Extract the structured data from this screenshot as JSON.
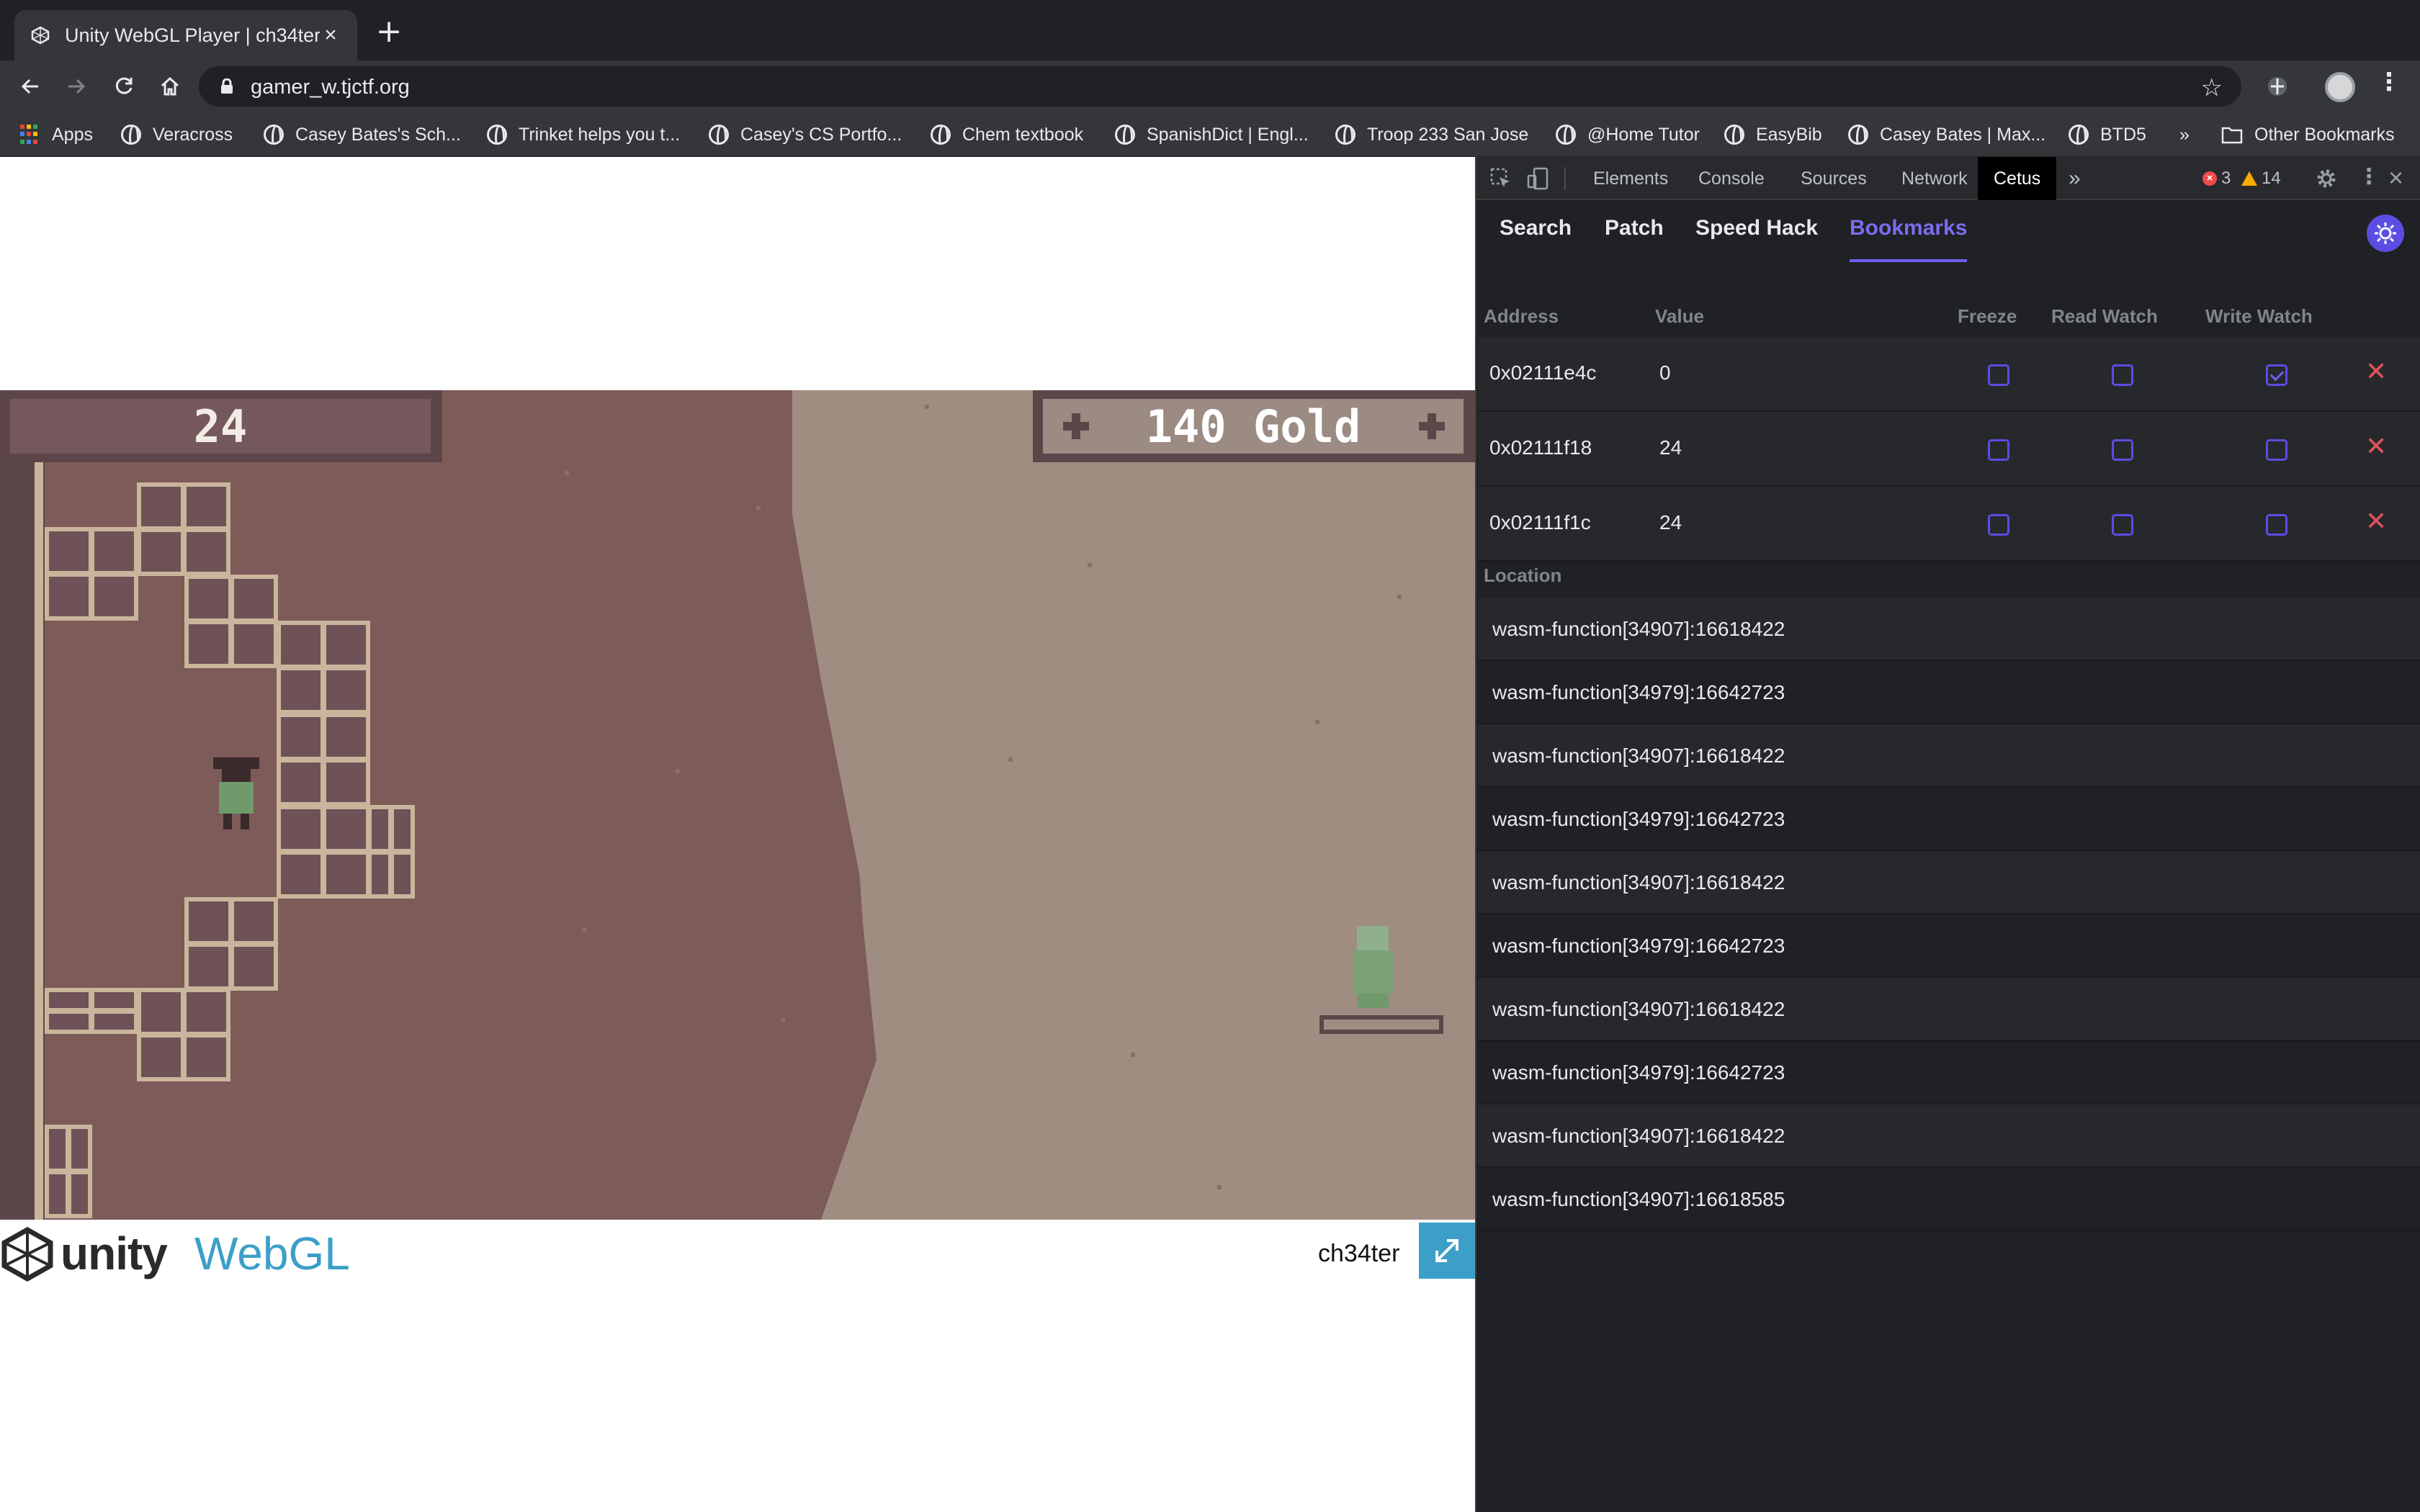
{
  "browser": {
    "tab_title": "Unity WebGL Player | ch34ter",
    "url": "gamer_w.tjctf.org",
    "bookmarks": [
      "Apps",
      "Veracross",
      "Casey Bates's Sch...",
      "Trinket helps you t...",
      "Casey's CS Portfo...",
      "Chem textbook",
      "SpanishDict | Engl...",
      "Troop 233 San Jose",
      "@Home Tutor",
      "EasyBib",
      "Casey Bates | Max...",
      "BTD5"
    ],
    "overflow": "»",
    "other_bookmarks": "Other Bookmarks"
  },
  "game": {
    "hud_number": "24",
    "hud_gold": "140 Gold",
    "footer_brand": "unity",
    "footer_webgl": "WebGL",
    "footer_title": "ch34ter"
  },
  "devtools": {
    "tabs": [
      "Elements",
      "Console",
      "Sources",
      "Network",
      "Cetus"
    ],
    "active_tab": "Cetus",
    "more": "»",
    "errors": "3",
    "warnings": "14",
    "cetus_tabs": [
      "Search",
      "Patch",
      "Speed Hack",
      "Bookmarks"
    ],
    "active_cetus_tab": "Bookmarks",
    "columns": {
      "address": "Address",
      "value": "Value",
      "freeze": "Freeze",
      "read_watch": "Read Watch",
      "write_watch": "Write Watch"
    },
    "bookmarks": [
      {
        "address": "0x02111e4c",
        "value": "0",
        "freeze": false,
        "read_watch": false,
        "write_watch": true
      },
      {
        "address": "0x02111f18",
        "value": "24",
        "freeze": false,
        "read_watch": false,
        "write_watch": false
      },
      {
        "address": "0x02111f1c",
        "value": "24",
        "freeze": false,
        "read_watch": false,
        "write_watch": false
      }
    ],
    "location_header": "Location",
    "locations": [
      "wasm-function[34907]:16618422",
      "wasm-function[34979]:16642723",
      "wasm-function[34907]:16618422",
      "wasm-function[34979]:16642723",
      "wasm-function[34907]:16618422",
      "wasm-function[34979]:16642723",
      "wasm-function[34907]:16618422",
      "wasm-function[34979]:16642723",
      "wasm-function[34907]:16618422",
      "wasm-function[34907]:16618585"
    ]
  },
  "colors": {
    "accent": "#6f5ff0",
    "delete": "#e0525a",
    "unity_blue": "#3d9fc8",
    "game_dirt": "#7d5b58",
    "game_sand": "#a08d82"
  }
}
